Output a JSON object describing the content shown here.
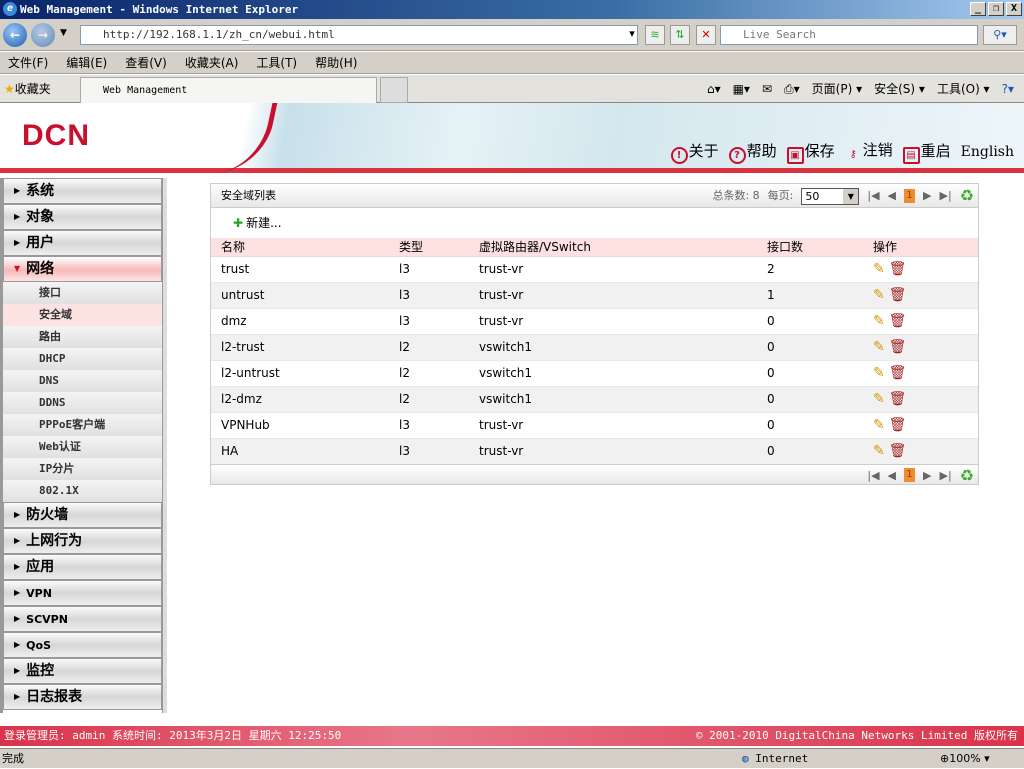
{
  "window": {
    "title": "Web Management - Windows Internet Explorer",
    "min": "_",
    "max": "❐",
    "close": "X"
  },
  "browser": {
    "url": "http://192.168.1.1/zh_cn/webui.html",
    "search_placeholder": "Live Search",
    "menu": [
      "文件(F)",
      "编辑(E)",
      "查看(V)",
      "收藏夹(A)",
      "工具(T)",
      "帮助(H)"
    ],
    "favorites": "收藏夹",
    "tab": "Web Management",
    "commands": [
      "页面(P) ▾",
      "安全(S) ▾",
      "工具(O) ▾"
    ]
  },
  "header": {
    "logo": "DCN",
    "links": [
      {
        "icon": "!",
        "label": "关于"
      },
      {
        "icon": "?",
        "label": "帮助"
      },
      {
        "icon": "▣",
        "label": "保存"
      },
      {
        "icon": "⚷",
        "label": "注销"
      },
      {
        "icon": "▤",
        "label": "重启"
      }
    ],
    "english": "English"
  },
  "sidebar": {
    "top_before": [
      "系统",
      "对象",
      "用户"
    ],
    "open": "网络",
    "sub": [
      "接口",
      "安全域",
      "路由",
      "DHCP",
      "DNS",
      "DDNS",
      "PPPoE客户端",
      "Web认证",
      "IP分片",
      "802.1X"
    ],
    "top_after": [
      "防火墙",
      "上网行为",
      "应用",
      "VPN",
      "SCVPN",
      "QoS",
      "监控",
      "日志报表"
    ]
  },
  "panel": {
    "title": "安全域列表",
    "total_label": "总条数: 8",
    "per_page_label": "每页:",
    "per_page": "50",
    "page": "1",
    "new_label": "新建...",
    "columns": [
      "名称",
      "类型",
      "虚拟路由器/VSwitch",
      "接口数",
      "操作"
    ],
    "rows": [
      [
        "trust",
        "l3",
        "trust-vr",
        "2"
      ],
      [
        "untrust",
        "l3",
        "trust-vr",
        "1"
      ],
      [
        "dmz",
        "l3",
        "trust-vr",
        "0"
      ],
      [
        "l2-trust",
        "l2",
        "vswitch1",
        "0"
      ],
      [
        "l2-untrust",
        "l2",
        "vswitch1",
        "0"
      ],
      [
        "l2-dmz",
        "l2",
        "vswitch1",
        "0"
      ],
      [
        "VPNHub",
        "l3",
        "trust-vr",
        "0"
      ],
      [
        "HA",
        "l3",
        "trust-vr",
        "0"
      ]
    ]
  },
  "footer": {
    "left": "登录管理员: admin 系统时间: 2013年3月2日 星期六 12:25:50",
    "right": "© 2001-2010 DigitalChina Networks Limited 版权所有"
  },
  "status": {
    "text": "完成",
    "zone": "Internet",
    "zoom": "100%"
  }
}
